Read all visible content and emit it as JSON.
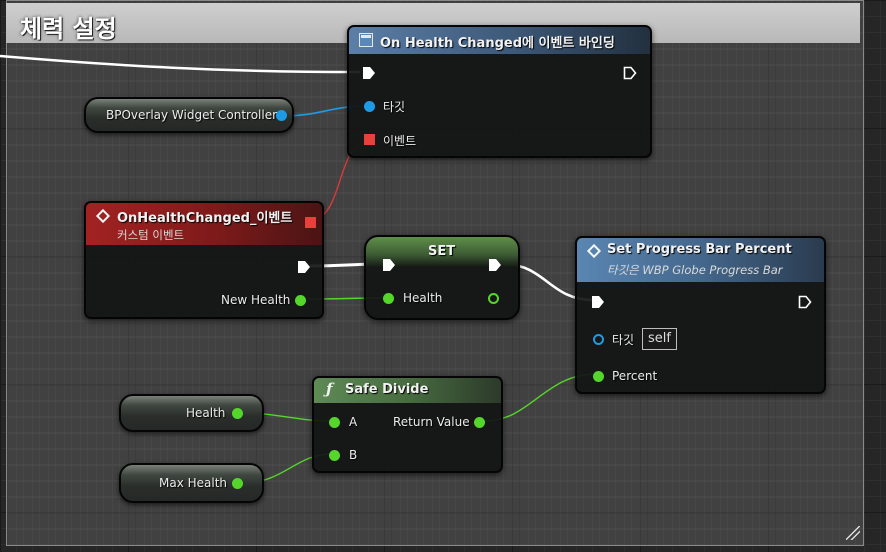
{
  "comment": {
    "title": "체력 설정"
  },
  "bind_node": {
    "title": "On Health Changed에 이벤트 바인딩",
    "target_label": "타깃",
    "event_label": "이벤트"
  },
  "controller_node": {
    "label": "BPOverlay Widget Controller"
  },
  "event_node": {
    "title": "OnHealthChanged_이벤트",
    "subtitle": "커스텀 이벤트",
    "output_label": "New Health"
  },
  "set_node": {
    "title": "SET",
    "input_label": "Health"
  },
  "progress_node": {
    "title": "Set Progress Bar Percent",
    "subtitle": "타깃은 WBP Globe Progress Bar",
    "target_label": "타깃",
    "target_value": "self",
    "percent_label": "Percent"
  },
  "divide_node": {
    "title": "Safe Divide",
    "input_a": "A",
    "input_b": "B",
    "output_label": "Return Value"
  },
  "health_var": {
    "label": "Health"
  },
  "max_health_var": {
    "label": "Max Health"
  },
  "colors": {
    "exec": "#ffffff",
    "object_pin": "#1e9be6",
    "float_pin": "#55d62a",
    "event_pin": "#e8403a",
    "bind_header": "#4c6f96",
    "event_header": "#8e1b1b",
    "set_header": "#4f7a3e",
    "progress_header": "#4f78a3",
    "divide_header": "#4a6b45"
  }
}
